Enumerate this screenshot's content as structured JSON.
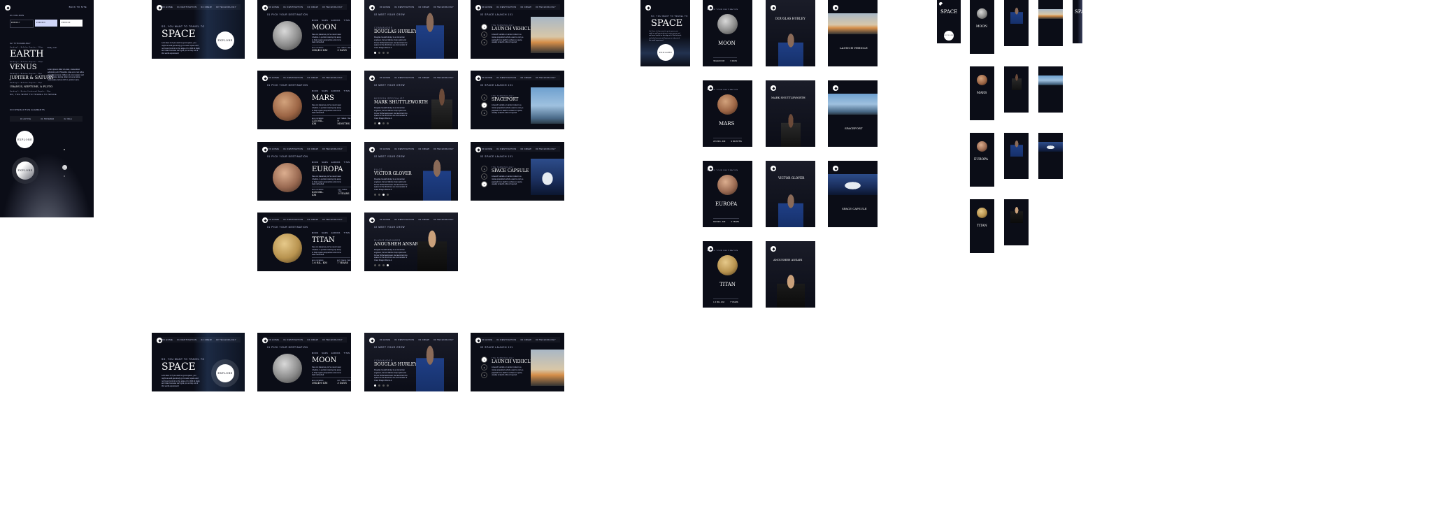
{
  "brand": {
    "dark": "#0b0d17",
    "light": "#d0d6f9",
    "white": "#ffffff",
    "logo_icon": "star-logo-icon"
  },
  "style_guide": {
    "back_link": "BACK TO SITE",
    "colors_heading": "01  COLORS",
    "color_labels": [
      "#0B0D17",
      "#D0D6F9",
      "#FFFFFF"
    ],
    "type_heading": "02  TYPOGRAPHY",
    "headings": [
      "EARTH",
      "VENUS",
      "JUPITER & SATURN",
      "URANUS, NEPTUNE, & PLUTO",
      "SO, YOU WANT TO TRAVEL TO SPACE"
    ],
    "heading_captions": [
      "Heading 1 - Bellefair Regular - 150px",
      "Heading 2 - Bellefair Regular - 100px",
      "Heading 3 - Bellefair Regular - 56px",
      "Heading 4 - Bellefair Regular - 32px",
      "Heading 5 - Barlow Condensed Regular - 28px"
    ],
    "body_heading": "Body text",
    "body_sample": "Lorem ipsum dolor sit amet, consectetur adipiscing elit. Phasellus vitae eros nec tellus convallis tempus. Nullam sit amet sapien sed lorem varius lacinia. Etiam sit amet tellus malesuada, luctus nibh in, pretium arcu.",
    "components_heading": "03  INTERACTIVE ELEMENTS",
    "nav_items": [
      "00 ACTIVE",
      "01 HOVERED",
      "02 IDLE"
    ],
    "explore_label": "EXPLORE"
  },
  "nav": [
    "00 HOME",
    "01 DESTINATION",
    "02 CREW",
    "03 TECHNOLOGY"
  ],
  "home": {
    "kicker": "SO, YOU WANT TO TRAVEL TO",
    "title": "SPACE",
    "explore": "EXPLORE",
    "body": "Let's face it; if you want to go to space, you might as well genuinely go to outer space and not hover kind of on the edge of it. Well sit back, and relax because we'll give you a truly out of this world experience!"
  },
  "destination_kicker": "01  PICK YOUR DESTINATION",
  "destination_tabs": [
    "MOON",
    "MARS",
    "EUROPA",
    "TITAN"
  ],
  "destinations": [
    {
      "name": "MOON",
      "distance": "384,400 KM",
      "travel": "3 DAYS"
    },
    {
      "name": "MARS",
      "distance": "225 MIL. KM",
      "travel": "9 MONTHS"
    },
    {
      "name": "EUROPA",
      "distance": "628 MIL. KM",
      "travel": "3 YEARS"
    },
    {
      "name": "TITAN",
      "distance": "1.6 BIL. KM",
      "travel": "7 YEARS"
    }
  ],
  "destination_labels": {
    "distance": "AVG. DISTANCE",
    "travel": "EST. TRAVEL TIME"
  },
  "destination_body": "See our planet as you've never seen it before. A perfect relaxing trip away to help regain perspective and come back refreshed.",
  "crew_kicker": "02  MEET YOUR CREW",
  "crew": [
    {
      "role": "COMMANDER",
      "name": "DOUGLAS HURLEY"
    },
    {
      "role": "MISSION SPECIALIST",
      "name": "MARK SHUTTLEWORTH"
    },
    {
      "role": "PILOT",
      "name": "VICTOR GLOVER"
    },
    {
      "role": "FLIGHT ENGINEER",
      "name": "ANOUSHEH ANSARI"
    }
  ],
  "crew_body": "Douglas Gerald Hurley is an American engineer, former Marine Corps pilot and former NASA astronaut. He launched into space for the third time as commander of Crew Dragon Demo-2.",
  "tech_kicker": "03  SPACE LAUNCH 101",
  "tech_term": "THE TERMINOLOGY...",
  "tech": [
    "LAUNCH VEHICLE",
    "SPACEPORT",
    "SPACE CAPSULE"
  ],
  "tech_numbers": [
    "1",
    "2",
    "3"
  ],
  "tech_body": "A launch vehicle or carrier rocket is a rocket-propelled vehicle used to carry a payload from Earth's surface to space, usually to Earth orbit or beyond."
}
